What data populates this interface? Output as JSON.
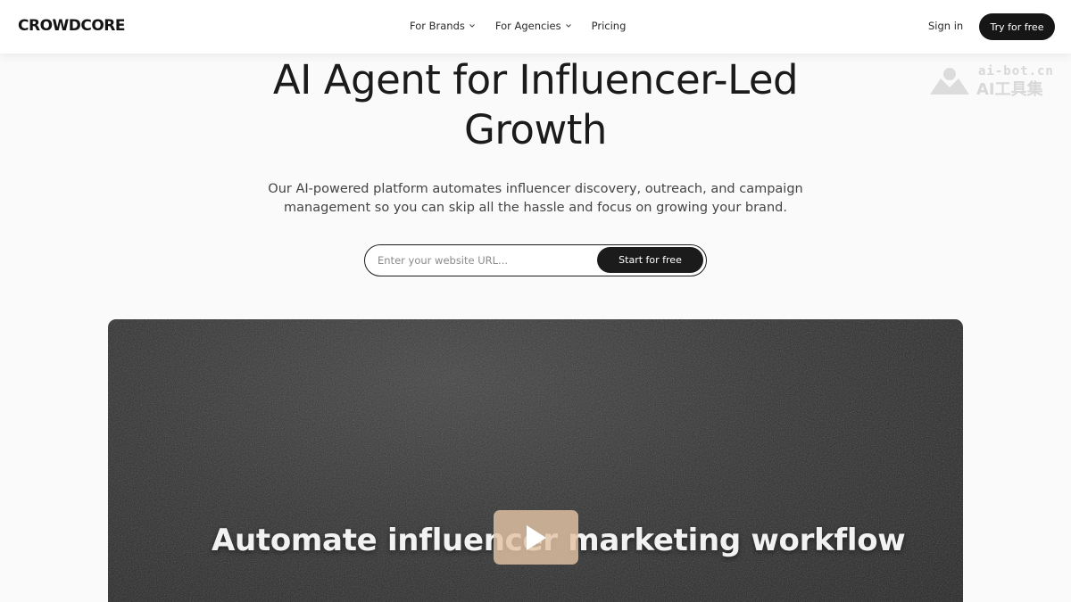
{
  "header": {
    "logo": "CROWDCORE",
    "nav": [
      {
        "label": "For Brands",
        "dropdown": true
      },
      {
        "label": "For Agencies",
        "dropdown": true
      },
      {
        "label": "Pricing",
        "dropdown": false
      }
    ],
    "sign_in": "Sign in",
    "cta": "Try for free"
  },
  "watermark": {
    "line1": "ai-bot.cn",
    "line2": "AI工具集"
  },
  "hero": {
    "title_line1": "AI Agent for Influencer-Led",
    "title_line2": "Growth",
    "subtitle_line1": "Our AI-powered platform automates influencer discovery, outreach, and campaign",
    "subtitle_line2": "management so you can skip all the hassle and focus on growing your brand.",
    "url_placeholder": "Enter your website URL...",
    "url_value": "",
    "start_button": "Start for free"
  },
  "video": {
    "caption": "Automate influencer marketing workflow",
    "play_icon": "play-icon"
  },
  "colors": {
    "primary": "#161616",
    "background": "#fafafa",
    "play_button": "#e2c3a5"
  }
}
